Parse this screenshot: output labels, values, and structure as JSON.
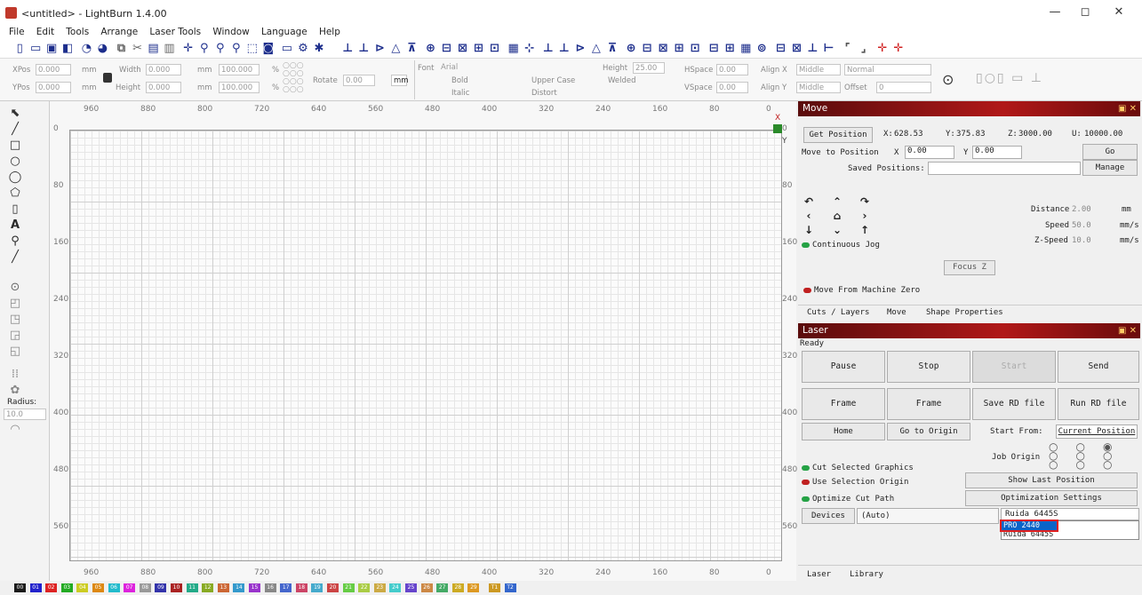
{
  "window": {
    "title": "<untitled> - LightBurn 1.4.00",
    "minimize": "—",
    "maximize": "◻",
    "close": "✕"
  },
  "menu": [
    "File",
    "Edit",
    "Tools",
    "Arrange",
    "Laser Tools",
    "Window",
    "Language",
    "Help"
  ],
  "options": {
    "xpos_label": "XPos",
    "xpos_value": "0.000",
    "ypos_label": "YPos",
    "ypos_value": "0.000",
    "unit": "mm",
    "width_label": "Width",
    "width_value": "0.000",
    "height_label": "Height",
    "height_value": "0.000",
    "scale_w": "100.000",
    "scale_h": "100.000",
    "pct": "%",
    "rotate_label": "Rotate",
    "rotate_value": "0.00",
    "rotate_unit": "mm",
    "font_label": "Font",
    "font_value": "Arial",
    "fheight_label": "Height",
    "fheight_value": "25.00",
    "bold": "Bold",
    "italic": "Italic",
    "upper": "Upper Case",
    "distort": "Distort",
    "welded": "Welded",
    "hspace_label": "HSpace",
    "hspace_value": "0.00",
    "vspace_label": "VSpace",
    "vspace_value": "0.00",
    "alignx_label": "Align X",
    "alignx_value": "Middle",
    "normal": "Normal",
    "aligny_label": "Align Y",
    "aligny_value": "Middle",
    "offset_label": "Offset",
    "offset_value": "0"
  },
  "lefttools": {
    "radius_label": "Radius:",
    "radius_value": "10.0"
  },
  "ruler": {
    "top": [
      "960",
      "880",
      "800",
      "720",
      "640",
      "560",
      "480",
      "400",
      "320",
      "240",
      "160",
      "80",
      "0"
    ],
    "left": [
      "0",
      "80",
      "160",
      "240",
      "320",
      "400",
      "480",
      "560"
    ],
    "right": [
      "0",
      "80",
      "160",
      "240",
      "320",
      "400",
      "480",
      "560"
    ],
    "y_marker": "Y",
    "x_marker": "X"
  },
  "move": {
    "title": "Move",
    "get_position": "Get Position",
    "x_label": "X:",
    "x_value": "628.53",
    "y_label": "Y:",
    "y_value": "375.83",
    "z_label": "Z:",
    "z_value": "3000.00",
    "u_label": "U:",
    "u_value": "10000.00",
    "move_to": "Move to Position",
    "mx_label": "X",
    "mx_value": "0.00",
    "my_label": "Y",
    "my_value": "0.00",
    "go": "Go",
    "saved_label": "Saved Positions:",
    "manage": "Manage",
    "distance_label": "Distance",
    "distance_value": "2.00",
    "distance_unit": "mm",
    "speed_label": "Speed",
    "speed_value": "50.0",
    "speed_unit": "mm/s",
    "zspeed_label": "Z-Speed",
    "zspeed_value": "10.0",
    "zspeed_unit": "mm/s",
    "continuous": "Continuous Jog",
    "focus": "Focus Z",
    "machine_zero": "Move From Machine Zero"
  },
  "tabs_mid": [
    "Cuts / Layers",
    "Move",
    "Shape Properties"
  ],
  "laser": {
    "title": "Laser",
    "status": "Ready",
    "pause": "Pause",
    "stop": "Stop",
    "start": "Start",
    "send": "Send",
    "frame1": "Frame",
    "frame2": "Frame",
    "save_rd": "Save RD file",
    "run_rd": "Run RD file",
    "home": "Home",
    "goto_origin": "Go to Origin",
    "start_from_label": "Start From:",
    "start_from_value": "Current Position",
    "job_origin": "Job Origin",
    "cut_selected": "Cut Selected Graphics",
    "use_selection": "Use Selection Origin",
    "optimize": "Optimize Cut Path",
    "show_last": "Show Last Position",
    "opt_settings": "Optimization Settings",
    "devices": "Devices",
    "auto": "(Auto)",
    "device_selected": "Ruida 6445S",
    "device_options": [
      "PRO 2440",
      "Ruida 6445S"
    ]
  },
  "tabs_bottom": [
    "Laser",
    "Library"
  ],
  "palette": [
    {
      "label": "00",
      "color": "#1a1a1a"
    },
    {
      "label": "01",
      "color": "#2222cc"
    },
    {
      "label": "02",
      "color": "#dd2222"
    },
    {
      "label": "03",
      "color": "#22aa22"
    },
    {
      "label": "04",
      "color": "#cccc22"
    },
    {
      "label": "05",
      "color": "#dd8811"
    },
    {
      "label": "06",
      "color": "#22bbcc"
    },
    {
      "label": "07",
      "color": "#dd22dd"
    },
    {
      "label": "08",
      "color": "#999999"
    },
    {
      "label": "09",
      "color": "#3333aa"
    },
    {
      "label": "10",
      "color": "#aa2222"
    },
    {
      "label": "11",
      "color": "#22aa88"
    },
    {
      "label": "12",
      "color": "#88aa22"
    },
    {
      "label": "13",
      "color": "#cc6633"
    },
    {
      "label": "14",
      "color": "#3399cc"
    },
    {
      "label": "15",
      "color": "#9933cc"
    },
    {
      "label": "16",
      "color": "#888888"
    },
    {
      "label": "17",
      "color": "#4466cc"
    },
    {
      "label": "18",
      "color": "#cc4466"
    },
    {
      "label": "19",
      "color": "#44aacc"
    },
    {
      "label": "20",
      "color": "#cc4444"
    },
    {
      "label": "21",
      "color": "#66cc44"
    },
    {
      "label": "22",
      "color": "#aacc44"
    },
    {
      "label": "23",
      "color": "#ccaa44"
    },
    {
      "label": "24",
      "color": "#44cccc"
    },
    {
      "label": "25",
      "color": "#6644cc"
    },
    {
      "label": "26",
      "color": "#cc8844"
    },
    {
      "label": "27",
      "color": "#44aa66"
    },
    {
      "label": "28",
      "color": "#ccaa22"
    },
    {
      "label": "29",
      "color": "#dd9922"
    },
    {
      "label": "T1",
      "color": "#cc9922"
    },
    {
      "label": "T2",
      "color": "#3366cc"
    }
  ]
}
